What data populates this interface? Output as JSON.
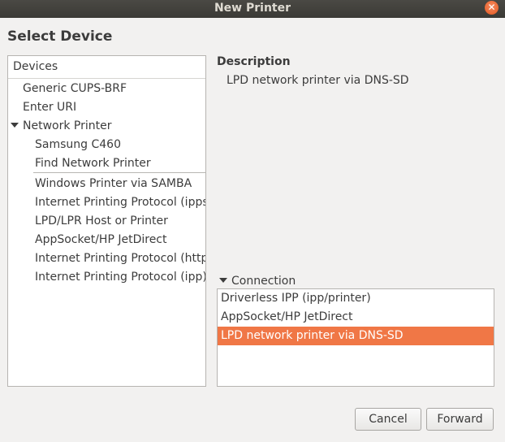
{
  "window": {
    "title": "New Printer",
    "close_glyph": "✕"
  },
  "heading": "Select Device",
  "devices": {
    "header": "Devices",
    "items": [
      "Generic CUPS-BRF",
      "Enter URI",
      "Network Printer",
      "Samsung C460",
      "Find Network Printer",
      "Windows Printer via SAMBA",
      "Internet Printing Protocol (ipps)",
      "LPD/LPR Host or Printer",
      "AppSocket/HP JetDirect",
      "Internet Printing Protocol (https)",
      "Internet Printing Protocol (ipp)"
    ]
  },
  "description": {
    "label": "Description",
    "value": "LPD network printer via DNS-SD"
  },
  "connection": {
    "label": "Connection",
    "items": [
      "Driverless IPP (ipp/printer)",
      "AppSocket/HP JetDirect",
      "LPD network printer via DNS-SD"
    ],
    "selected": "LPD network printer via DNS-SD"
  },
  "buttons": {
    "cancel": "Cancel",
    "forward": "Forward"
  },
  "colors": {
    "selection": "#f07746",
    "titlebar": "#3b3a36",
    "close": "#e5571f"
  }
}
